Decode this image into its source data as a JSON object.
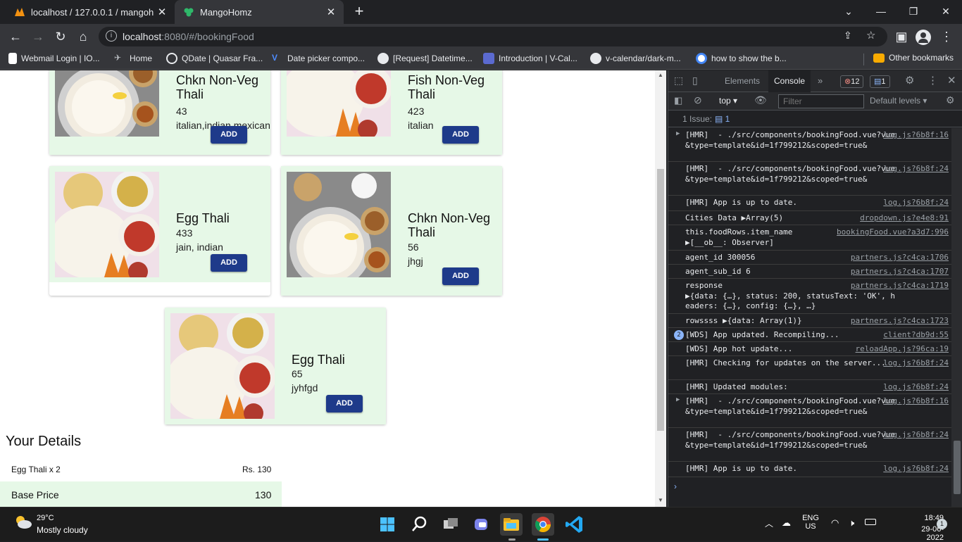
{
  "browser": {
    "tabs": [
      {
        "title": "localhost / 127.0.0.1 / mangohom",
        "active": false
      },
      {
        "title": "MangoHomz",
        "active": true
      }
    ],
    "url_host": "localhost",
    "url_rest": ":8080/#/bookingFood",
    "bookmarks": [
      "Webmail Login | IO...",
      "Home",
      "QDate | Quasar Fra...",
      "Date picker compo...",
      "[Request] Datetime...",
      "Introduction | V-Cal...",
      "v-calendar/dark-m...",
      "how to show the b...",
      "Other bookmarks"
    ]
  },
  "page": {
    "cards": [
      {
        "name": "Chkn Non-Veg Thali",
        "price": "43",
        "cuisine": "italian,indian,mexican",
        "add": "ADD",
        "img": "biryani"
      },
      {
        "name": "Fish Non-Veg Thali",
        "price": "423",
        "cuisine": "italian",
        "add": "ADD",
        "img": "rice"
      },
      {
        "name": "Egg Thali",
        "price": "433",
        "cuisine": "jain, indian",
        "add": "ADD",
        "img": "rice"
      },
      {
        "name": "Chkn Non-Veg Thali",
        "price": "56",
        "cuisine": "jhgj",
        "add": "ADD",
        "img": "biryani"
      },
      {
        "name": "Egg Thali",
        "price": "65",
        "cuisine": "jyhfgd",
        "add": "ADD",
        "img": "rice"
      }
    ],
    "details_title": "Your Details",
    "order_item": "Egg Thali x 2",
    "order_amount": "Rs. 130",
    "base_label": "Base Price",
    "base_value": "130"
  },
  "devtools": {
    "tabs": [
      "Elements",
      "Console"
    ],
    "error_count": "12",
    "message_count": "1",
    "context": "top",
    "filter_placeholder": "Filter",
    "levels": "Default levels",
    "issues": "1 Issue:",
    "issues_count": "1",
    "log": [
      {
        "msg": "[HMR]  - ./src/components/bookingFood.vue?vue&type=template&id=1f799212&scoped=true&",
        "src": "log.js?6b8f:16",
        "arrow": true
      },
      {
        "msg": "[HMR]  - ./src/components/bookingFood.vue?vue&type=template&id=1f799212&scoped=true&",
        "src": "log.js?6b8f:24",
        "arrow": false
      },
      {
        "msg": "[HMR] App is up to date.",
        "src": "log.js?6b8f:24",
        "arrow": false
      },
      {
        "msg": "Cities Data ▶Array(5)",
        "src": "dropdown.js?e4e8:91",
        "arrow": false
      },
      {
        "msg": "this.foodRows.item_name\n▶[__ob__: Observer]",
        "src": "bookingFood.vue?a3d7:996",
        "arrow": false
      },
      {
        "msg": "agent_id 300056",
        "src": "partners.js?c4ca:1706",
        "arrow": false
      },
      {
        "msg": "agent_sub_id 6",
        "src": "partners.js?c4ca:1707",
        "arrow": false
      },
      {
        "msg": "response\n▶{data: {…}, status: 200, statusText: 'OK', headers: {…}, config: {…}, …}",
        "src": "partners.js?c4ca:1719",
        "arrow": false
      },
      {
        "msg": "rowssss ▶{data: Array(1)}",
        "src": "partners.js?c4ca:1723",
        "arrow": false
      },
      {
        "msg": "[WDS] App updated. Recompiling...",
        "src": "client?db9d:55",
        "arrow": false,
        "badge": "2"
      },
      {
        "msg": "[WDS] App hot update...",
        "src": "reloadApp.js?96ca:19",
        "arrow": false
      },
      {
        "msg": "[HMR] Checking for updates on the server...",
        "src": "log.js?6b8f:24",
        "arrow": false
      },
      {
        "msg": "[HMR] Updated modules:",
        "src": "log.js?6b8f:24",
        "arrow": false
      },
      {
        "msg": "[HMR]  - ./src/components/bookingFood.vue?vue&type=template&id=1f799212&scoped=true&",
        "src": "log.js?6b8f:16",
        "arrow": true
      },
      {
        "msg": "[HMR]  - ./src/components/bookingFood.vue?vue&type=template&id=1f799212&scoped=true&",
        "src": "log.js?6b8f:24",
        "arrow": false
      },
      {
        "msg": "[HMR] App is up to date.",
        "src": "log.js?6b8f:24",
        "arrow": false
      }
    ]
  },
  "taskbar": {
    "temp": "29°C",
    "weather": "Mostly cloudy",
    "lang1": "ENG",
    "lang2": "US",
    "time": "18:49",
    "date": "29-06-2022",
    "notif": "1"
  }
}
